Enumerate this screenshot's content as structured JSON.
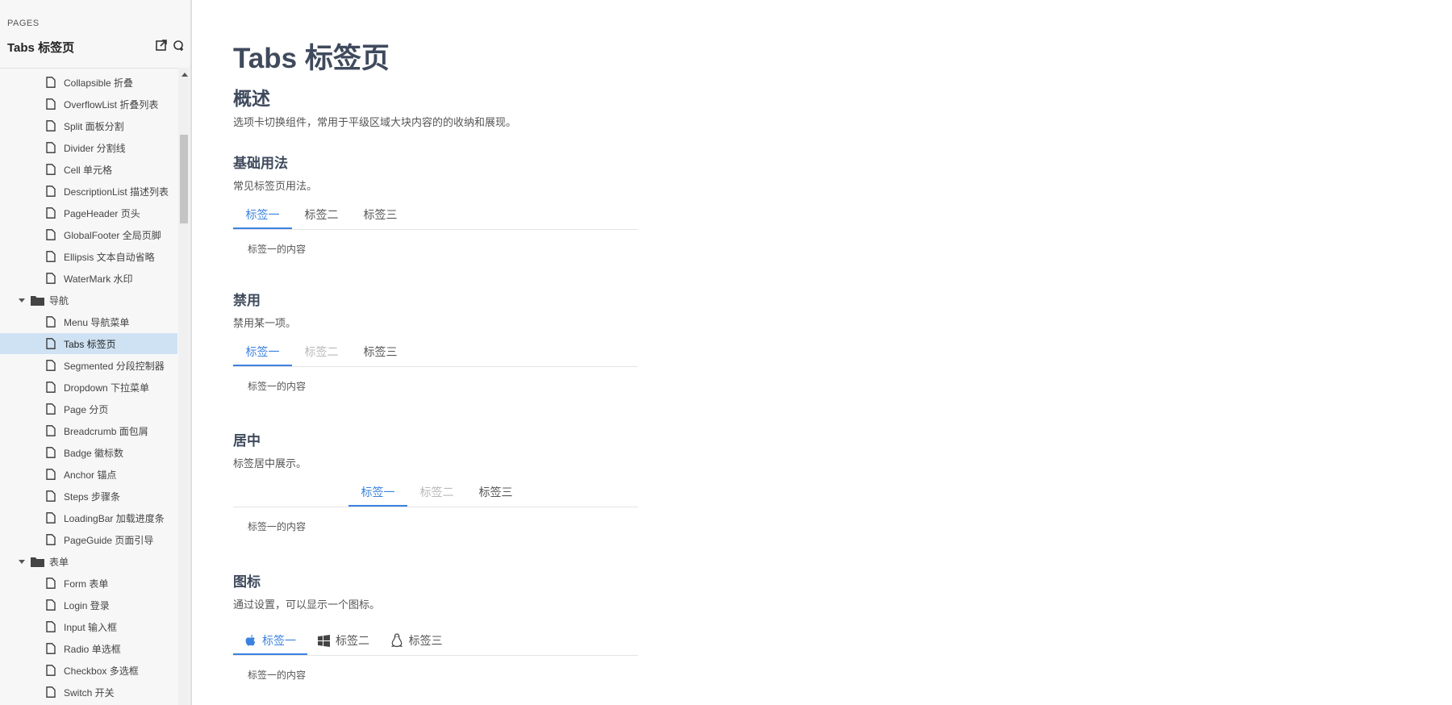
{
  "sidebar": {
    "pages_label": "PAGES",
    "title": "Tabs 标签页",
    "items": [
      {
        "label": "Collapsible 折叠",
        "kind": "doc"
      },
      {
        "label": "OverflowList 折叠列表",
        "kind": "doc"
      },
      {
        "label": "Split 面板分割",
        "kind": "doc"
      },
      {
        "label": "Divider 分割线",
        "kind": "doc"
      },
      {
        "label": "Cell 单元格",
        "kind": "doc"
      },
      {
        "label": "DescriptionList 描述列表",
        "kind": "doc"
      },
      {
        "label": "PageHeader 页头",
        "kind": "doc"
      },
      {
        "label": "GlobalFooter 全局页脚",
        "kind": "doc"
      },
      {
        "label": "Ellipsis 文本自动省略",
        "kind": "doc"
      },
      {
        "label": "WaterMark 水印",
        "kind": "doc"
      },
      {
        "label": "导航",
        "kind": "folder"
      },
      {
        "label": "Menu 导航菜单",
        "kind": "doc"
      },
      {
        "label": "Tabs 标签页",
        "kind": "doc",
        "active": true
      },
      {
        "label": "Segmented 分段控制器",
        "kind": "doc"
      },
      {
        "label": "Dropdown 下拉菜单",
        "kind": "doc"
      },
      {
        "label": "Page 分页",
        "kind": "doc"
      },
      {
        "label": "Breadcrumb 面包屑",
        "kind": "doc"
      },
      {
        "label": "Badge 徽标数",
        "kind": "doc"
      },
      {
        "label": "Anchor 锚点",
        "kind": "doc"
      },
      {
        "label": "Steps 步骤条",
        "kind": "doc"
      },
      {
        "label": "LoadingBar 加载进度条",
        "kind": "doc"
      },
      {
        "label": "PageGuide 页面引导",
        "kind": "doc"
      },
      {
        "label": "表单",
        "kind": "folder"
      },
      {
        "label": "Form 表单",
        "kind": "doc"
      },
      {
        "label": "Login 登录",
        "kind": "doc"
      },
      {
        "label": "Input 输入框",
        "kind": "doc"
      },
      {
        "label": "Radio 单选框",
        "kind": "doc"
      },
      {
        "label": "Checkbox 多选框",
        "kind": "doc"
      },
      {
        "label": "Switch 开关",
        "kind": "doc"
      }
    ]
  },
  "main": {
    "title": "Tabs 标签页",
    "overview_heading": "概述",
    "overview_desc": "选项卡切换组件，常用于平级区域大块内容的的收纳和展现。",
    "sections": {
      "basic": {
        "heading": "基础用法",
        "desc": "常见标签页用法。",
        "tabs": [
          "标签一",
          "标签二",
          "标签三"
        ],
        "content": "标签一的内容"
      },
      "disabled": {
        "heading": "禁用",
        "desc": "禁用某一项。",
        "tabs": [
          "标签一",
          "标签二",
          "标签三"
        ],
        "content": "标签一的内容"
      },
      "center": {
        "heading": "居中",
        "desc": "标签居中展示。",
        "tabs": [
          "标签一",
          "标签二",
          "标签三"
        ],
        "content": "标签一的内容"
      },
      "icon": {
        "heading": "图标",
        "desc": "通过设置，可以显示一个图标。",
        "tabs": [
          {
            "label": "标签一",
            "icon": "apple-icon"
          },
          {
            "label": "标签二",
            "icon": "windows-icon"
          },
          {
            "label": "标签三",
            "icon": "linux-icon"
          }
        ],
        "content": "标签一的内容"
      }
    }
  },
  "colors": {
    "accent": "#3b82e0",
    "heading": "#3f4a5c",
    "active_row": "#cfe2f3",
    "disabled_tab": "#b8b8b8"
  }
}
